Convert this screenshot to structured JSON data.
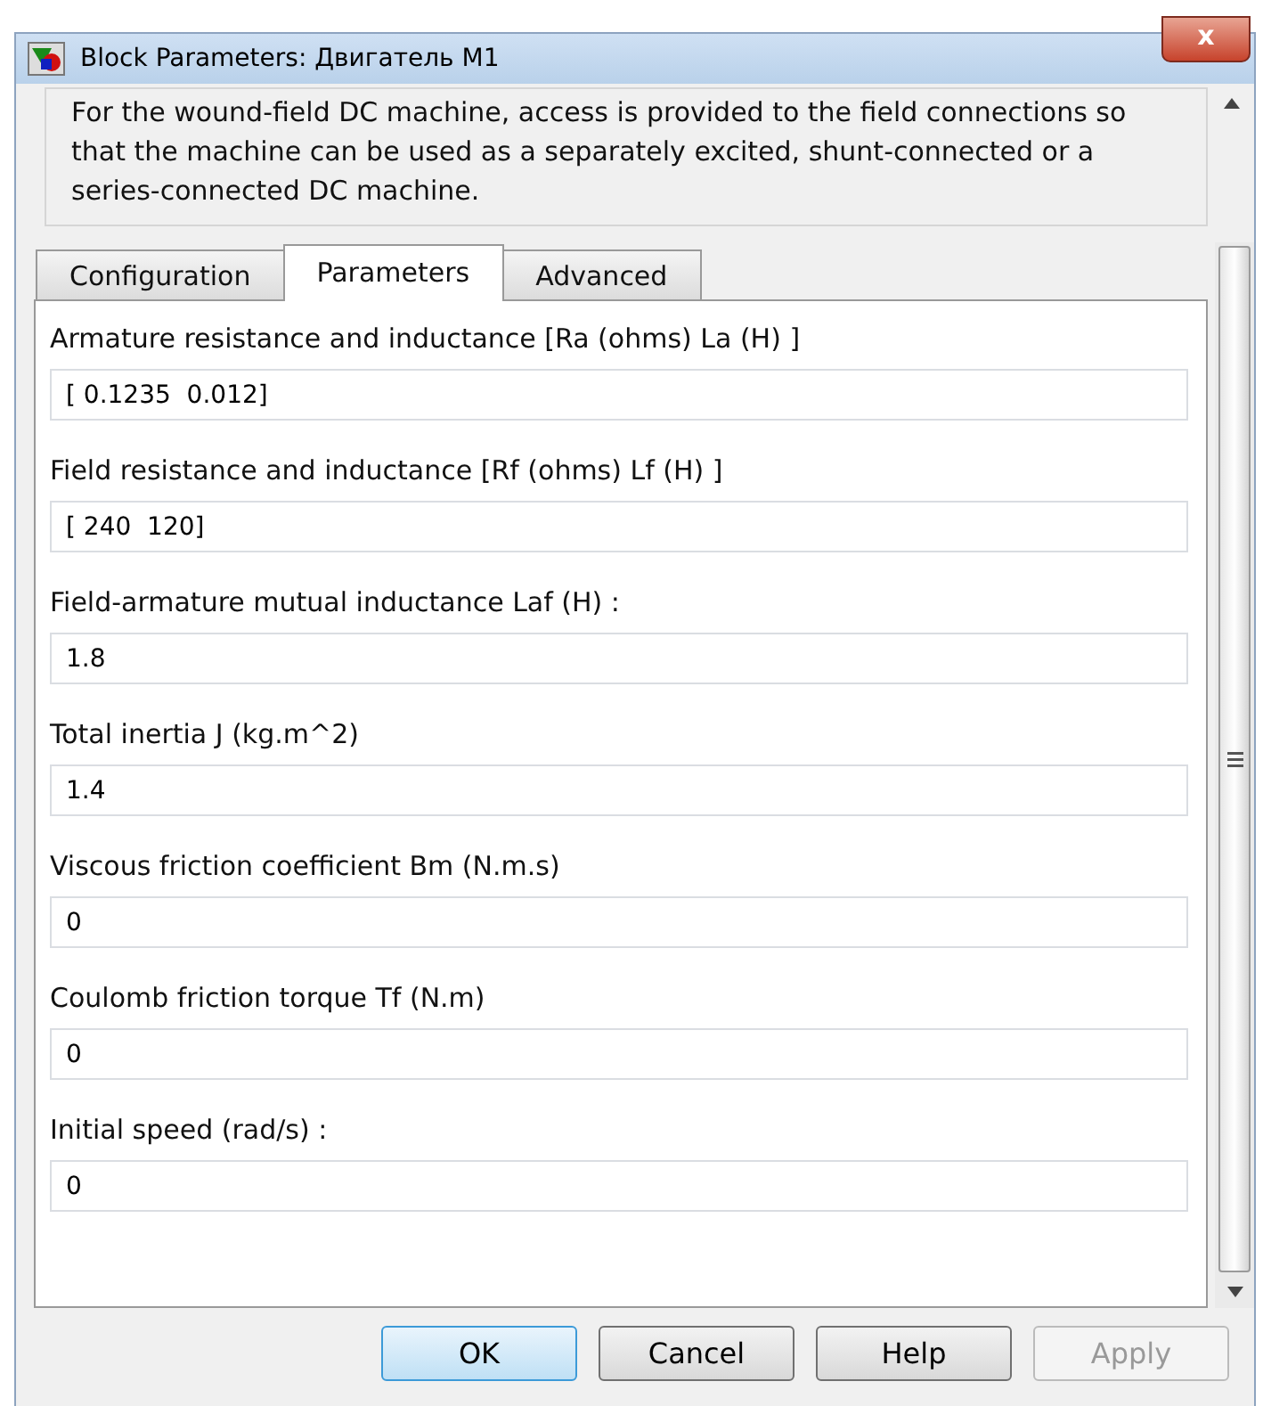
{
  "window": {
    "title": "Block Parameters: Двигатель М1",
    "close": "x"
  },
  "description": "For the wound-field DC machine, access is provided to the field connections so that the machine can be used as a separately excited, shunt-connected or a series-connected  DC machine.",
  "tabs": [
    {
      "label": "Configuration",
      "selected": false
    },
    {
      "label": "Parameters",
      "selected": true
    },
    {
      "label": "Advanced",
      "selected": false
    }
  ],
  "parameters": [
    {
      "label": "Armature resistance and inductance [Ra (ohms) La (H) ]",
      "value": "[ 0.1235  0.012]"
    },
    {
      "label": "Field resistance and inductance [Rf (ohms) Lf (H) ]",
      "value": "[ 240  120]"
    },
    {
      "label": "Field-armature mutual inductance Laf (H) :",
      "value": "1.8"
    },
    {
      "label": "Total inertia J (kg.m^2)",
      "value": "1.4"
    },
    {
      "label": "Viscous friction coefficient Bm (N.m.s)",
      "value": "0"
    },
    {
      "label": "Coulomb friction torque Tf (N.m)",
      "value": "0"
    },
    {
      "label": "Initial speed (rad/s) :",
      "value": "0"
    }
  ],
  "buttons": [
    {
      "label": "OK",
      "default": true,
      "disabled": false
    },
    {
      "label": "Cancel",
      "default": false,
      "disabled": false
    },
    {
      "label": "Help",
      "default": false,
      "disabled": false
    },
    {
      "label": "Apply",
      "default": false,
      "disabled": true
    }
  ]
}
